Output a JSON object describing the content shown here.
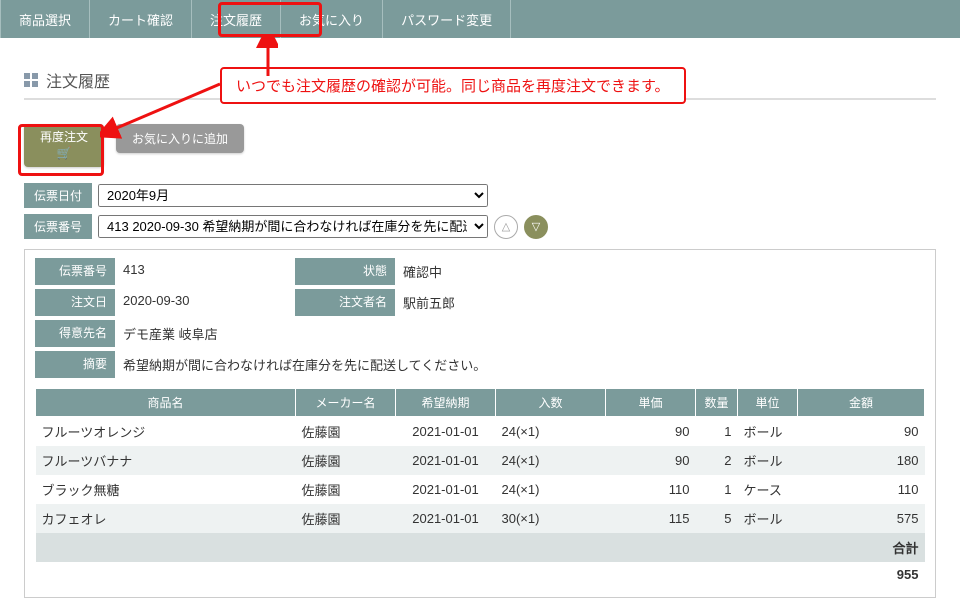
{
  "nav": {
    "items": [
      "商品選択",
      "カート確認",
      "注文履歴",
      "お気に入り",
      "パスワード変更"
    ]
  },
  "page_title": "注文履歴",
  "annotation": "いつでも注文履歴の確認が可能。同じ商品を再度注文できます。",
  "buttons": {
    "reorder": "再度注文",
    "add_favorite": "お気に入りに追加"
  },
  "filters": {
    "date_label": "伝票日付",
    "date_value": "2020年9月",
    "number_label": "伝票番号",
    "number_value": "413 2020-09-30 希望納期が間に合わなければ在庫分を先に配送"
  },
  "order": {
    "labels": {
      "slip_no": "伝票番号",
      "status": "状態",
      "order_date": "注文日",
      "orderer": "注文者名",
      "customer": "得意先名",
      "note": "摘要"
    },
    "slip_no": "413",
    "status": "確認中",
    "order_date": "2020-09-30",
    "orderer": "駅前五郎",
    "customer": "デモ産業  岐阜店",
    "note": "希望納期が間に合わなければ在庫分を先に配送してください。"
  },
  "table": {
    "headers": [
      "商品名",
      "メーカー名",
      "希望納期",
      "入数",
      "単価",
      "数量",
      "単位",
      "金額"
    ],
    "rows": [
      {
        "name": "フルーツオレンジ",
        "maker": "佐藤園",
        "deliv": "2021-01-01",
        "pack": "24(×1)",
        "price": 90,
        "qty": 1,
        "unit": "ボール",
        "amount": 90
      },
      {
        "name": "フルーツバナナ",
        "maker": "佐藤園",
        "deliv": "2021-01-01",
        "pack": "24(×1)",
        "price": 90,
        "qty": 2,
        "unit": "ボール",
        "amount": 180
      },
      {
        "name": "ブラック無糖",
        "maker": "佐藤園",
        "deliv": "2021-01-01",
        "pack": "24(×1)",
        "price": 110,
        "qty": 1,
        "unit": "ケース",
        "amount": 110
      },
      {
        "name": "カフェオレ",
        "maker": "佐藤園",
        "deliv": "2021-01-01",
        "pack": "30(×1)",
        "price": 115,
        "qty": 5,
        "unit": "ボール",
        "amount": 575
      }
    ],
    "total_label": "合計",
    "total": 955
  }
}
